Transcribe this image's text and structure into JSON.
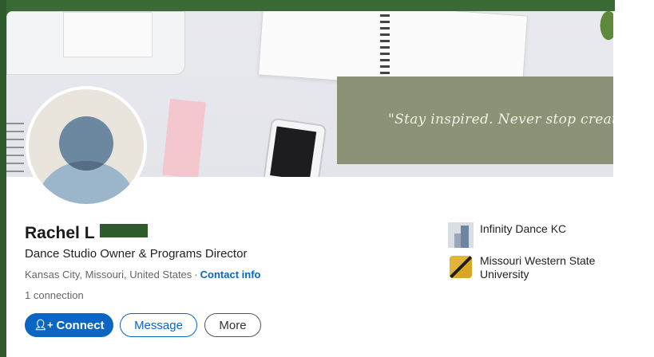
{
  "banner": {
    "quote": "\"Stay inspired. Never stop creati"
  },
  "profile": {
    "name": "Rachel L",
    "headline": "Dance Studio Owner & Programs Director",
    "location": "Kansas City, Missouri, United States",
    "separator": "·",
    "contact_info": "Contact info",
    "connections": "1 connection"
  },
  "actions": {
    "connect": "Connect",
    "message": "Message",
    "more": "More"
  },
  "organizations": [
    {
      "name": "Infinity Dance KC"
    },
    {
      "name": "Missouri Western State University"
    }
  ],
  "icons": {
    "connect": "add-person-icon"
  },
  "colors": {
    "accent": "#0a66c2",
    "banner_box": "#8a9375",
    "frame": "#2f5a2c"
  }
}
